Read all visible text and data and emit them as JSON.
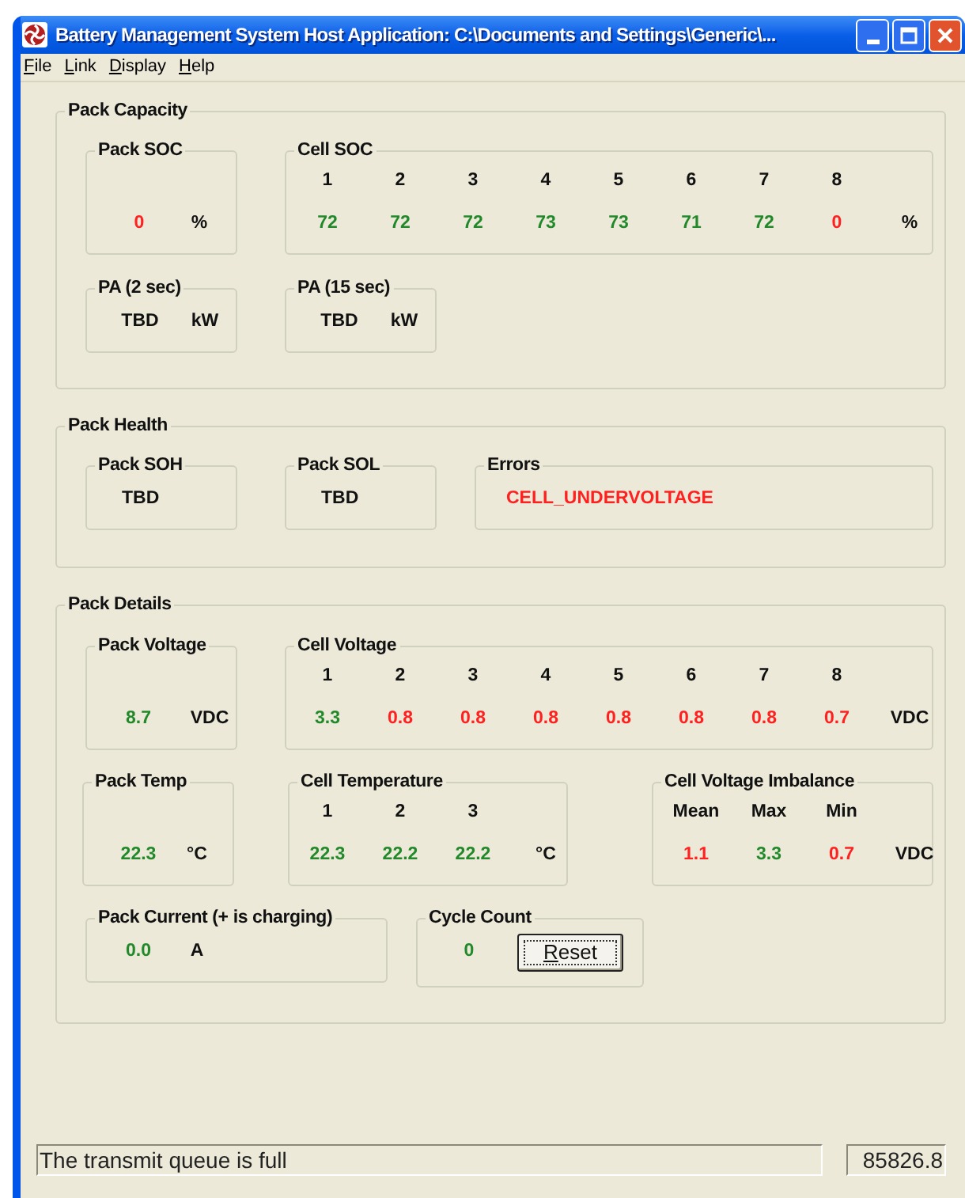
{
  "window": {
    "title": "Battery Management System Host Application: C:\\Documents and Settings\\Generic\\..."
  },
  "menu": [
    {
      "label": "File"
    },
    {
      "label": "Link"
    },
    {
      "label": "Display"
    },
    {
      "label": "Help"
    }
  ],
  "sections": [
    {
      "title": "Pack Capacity",
      "boxes": [
        {
          "title": "Pack SOC",
          "readings": [
            {
              "text": "0",
              "color": "#ff2020"
            }
          ],
          "unit": "%"
        },
        {
          "title": "Cell SOC",
          "headers": [
            "1",
            "2",
            "3",
            "4",
            "5",
            "6",
            "7",
            "8"
          ],
          "readings": [
            {
              "text": "72",
              "color": "#22892b"
            },
            {
              "text": "72",
              "color": "#22892b"
            },
            {
              "text": "72",
              "color": "#22892b"
            },
            {
              "text": "73",
              "color": "#22892b"
            },
            {
              "text": "73",
              "color": "#22892b"
            },
            {
              "text": "71",
              "color": "#22892b"
            },
            {
              "text": "72",
              "color": "#22892b"
            },
            {
              "text": "0",
              "color": "#ff2020"
            }
          ],
          "unit": "%"
        },
        {
          "title": "PA (2 sec)",
          "readings": [
            {
              "text": "TBD"
            }
          ],
          "unit": "kW"
        },
        {
          "title": "PA (15 sec)",
          "readings": [
            {
              "text": "TBD"
            }
          ],
          "unit": "kW"
        }
      ]
    },
    {
      "title": "Pack Health",
      "boxes": [
        {
          "title": "Pack SOH",
          "readings": [
            {
              "text": "TBD"
            }
          ]
        },
        {
          "title": "Pack SOL",
          "readings": [
            {
              "text": "TBD"
            }
          ]
        },
        {
          "title": "Errors",
          "readings": [
            {
              "text": "CELL_UNDERVOLTAGE",
              "color": "#ff2020"
            }
          ]
        }
      ]
    },
    {
      "title": "Pack Details",
      "boxes": [
        {
          "title": "Pack Voltage",
          "readings": [
            {
              "text": "8.7",
              "color": "#22892b"
            }
          ],
          "unit": "VDC"
        },
        {
          "title": "Cell Voltage",
          "headers": [
            "1",
            "2",
            "3",
            "4",
            "5",
            "6",
            "7",
            "8"
          ],
          "readings": [
            {
              "text": "3.3",
              "color": "#22892b"
            },
            {
              "text": "0.8",
              "color": "#ff2020"
            },
            {
              "text": "0.8",
              "color": "#ff2020"
            },
            {
              "text": "0.8",
              "color": "#ff2020"
            },
            {
              "text": "0.8",
              "color": "#ff2020"
            },
            {
              "text": "0.8",
              "color": "#ff2020"
            },
            {
              "text": "0.8",
              "color": "#ff2020"
            },
            {
              "text": "0.7",
              "color": "#ff2020"
            }
          ],
          "unit": "VDC"
        },
        {
          "title": "Pack Temp",
          "readings": [
            {
              "text": "22.3",
              "color": "#22892b"
            }
          ],
          "unit": "°C"
        },
        {
          "title": "Cell Temperature",
          "headers": [
            "1",
            "2",
            "3"
          ],
          "readings": [
            {
              "text": "22.3",
              "color": "#22892b"
            },
            {
              "text": "22.2",
              "color": "#22892b"
            },
            {
              "text": "22.2",
              "color": "#22892b"
            }
          ],
          "unit": "°C"
        },
        {
          "title": "Cell Voltage Imbalance",
          "headers": [
            "Mean",
            "Max",
            "Min"
          ],
          "readings": [
            {
              "text": "1.1",
              "color": "#ff2020"
            },
            {
              "text": "3.3",
              "color": "#22892b"
            },
            {
              "text": "0.7",
              "color": "#ff2020"
            }
          ],
          "unit": "VDC"
        },
        {
          "title": "Pack Current (+ is charging)",
          "readings": [
            {
              "text": "0.0",
              "color": "#22892b"
            }
          ],
          "unit": "A"
        },
        {
          "title": "Cycle Count",
          "readings": [
            {
              "text": "0",
              "color": "#22892b"
            }
          ],
          "button": "Reset"
        }
      ]
    }
  ],
  "status_bar": {
    "message": "The transmit queue is full",
    "value": "85826.8"
  }
}
